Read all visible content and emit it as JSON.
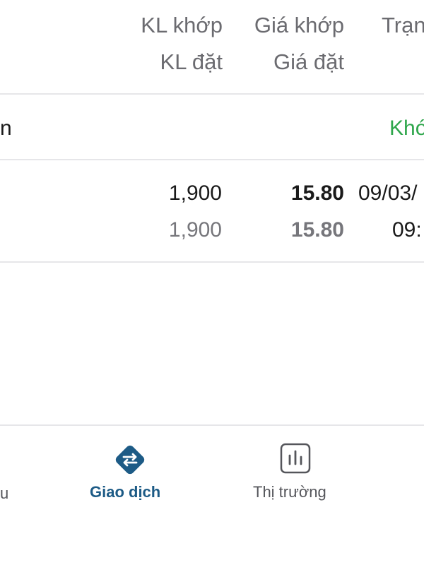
{
  "table": {
    "header": {
      "matched_qty": "KL khớp",
      "order_qty": "KL đặt",
      "matched_price": "Giá khớp",
      "order_price": "Giá đặt",
      "status_partial": "Trạn"
    },
    "group_row": {
      "left_partial": "n",
      "right_partial": "Khớ"
    },
    "order_row": {
      "matched_qty": "1,900",
      "order_qty": "1,900",
      "matched_price": "15.80",
      "order_price": "15.80",
      "date_partial": "09/03/",
      "time_partial": "09:"
    }
  },
  "bottom_nav": {
    "left_partial_label": "u",
    "trade_label": "Giao dịch",
    "market_label": "Thị trường",
    "trade_icon": "swap-arrows-icon",
    "market_icon": "bar-chart-icon"
  },
  "colors": {
    "accent": "#1d5b86",
    "green": "#2ea64b",
    "muted_text": "#76767b",
    "divider": "#e6e6e9"
  }
}
